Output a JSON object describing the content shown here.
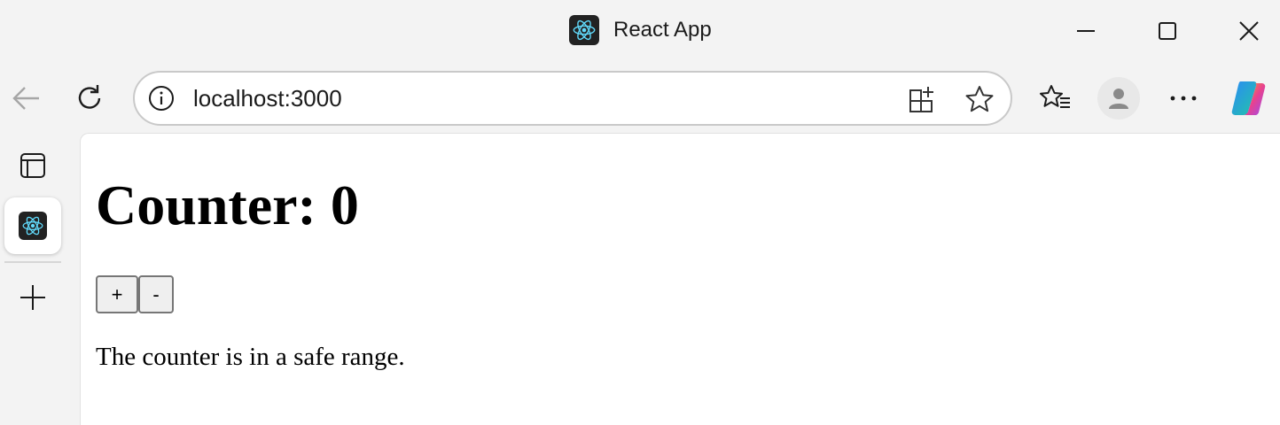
{
  "window": {
    "title": "React App",
    "icon": "react-logo-icon"
  },
  "controls": {
    "minimize": "minimize-icon",
    "maximize": "maximize-icon",
    "close": "close-icon"
  },
  "toolbar": {
    "url": "localhost:3000"
  },
  "page": {
    "heading": "Counter: 0",
    "increment_label": "+",
    "decrement_label": "-",
    "status": "The counter is in a safe range."
  },
  "colors": {
    "react_cyan": "#61dafb",
    "icon_dark": "#222222"
  }
}
